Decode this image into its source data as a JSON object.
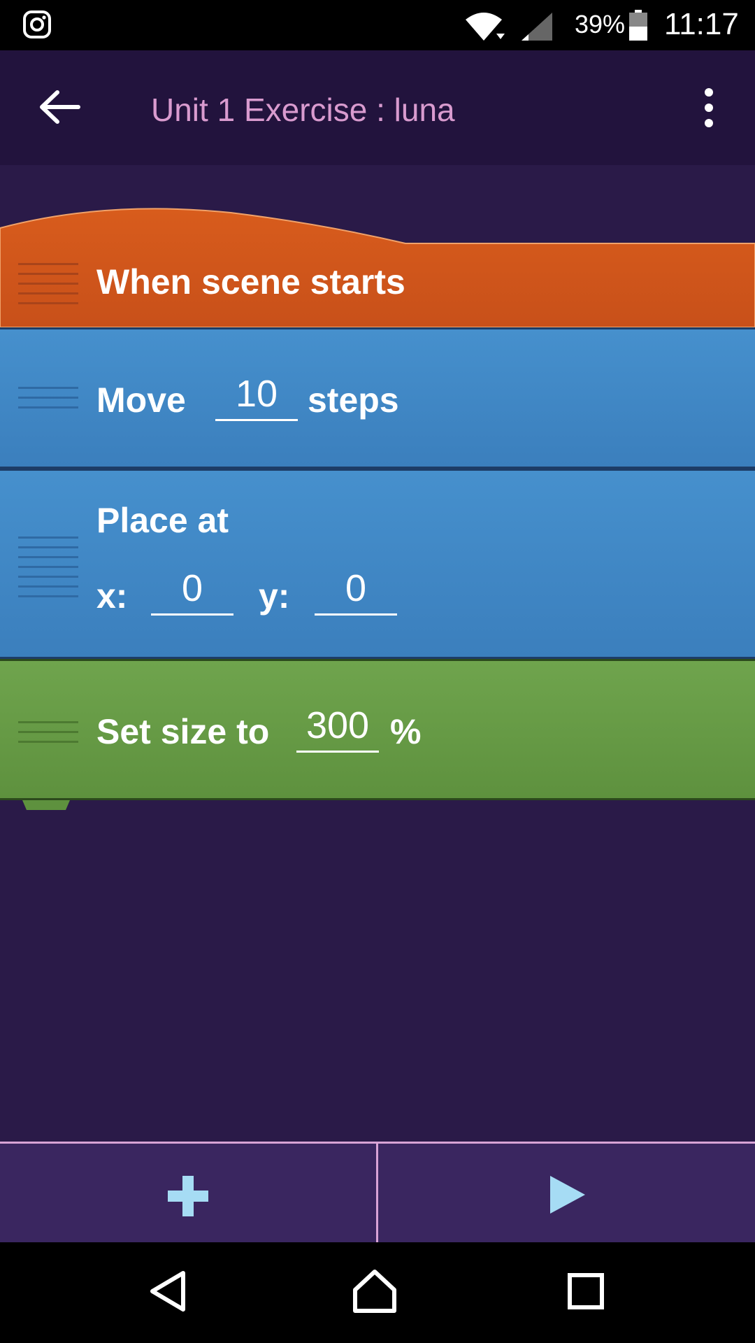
{
  "status_bar": {
    "battery_percent": "39%",
    "time": "11:17"
  },
  "app_bar": {
    "title": "Unit 1 Exercise : luna"
  },
  "blocks": {
    "hat_label": "When scene starts",
    "move": {
      "label": "Move",
      "value": "10",
      "suffix": "steps"
    },
    "place": {
      "label": "Place at",
      "x_label": "x:",
      "x_value": "0",
      "y_label": "y:",
      "y_value": "0"
    },
    "size": {
      "label": "Set size to",
      "value": "300",
      "suffix": "%"
    }
  },
  "colors": {
    "hat": "#d2581a",
    "motion": "#4690cd",
    "looks": "#6fa44d",
    "background": "#2a1a48",
    "accent": "#d99bcf",
    "toolbar_icon": "#a6dcf4"
  },
  "icons": [
    "instagram-icon",
    "wifi-icon",
    "signal-icon",
    "battery-icon",
    "back-arrow-icon",
    "more-vert-icon",
    "plus-icon",
    "play-icon",
    "nav-back-icon",
    "nav-home-icon",
    "nav-recents-icon"
  ]
}
